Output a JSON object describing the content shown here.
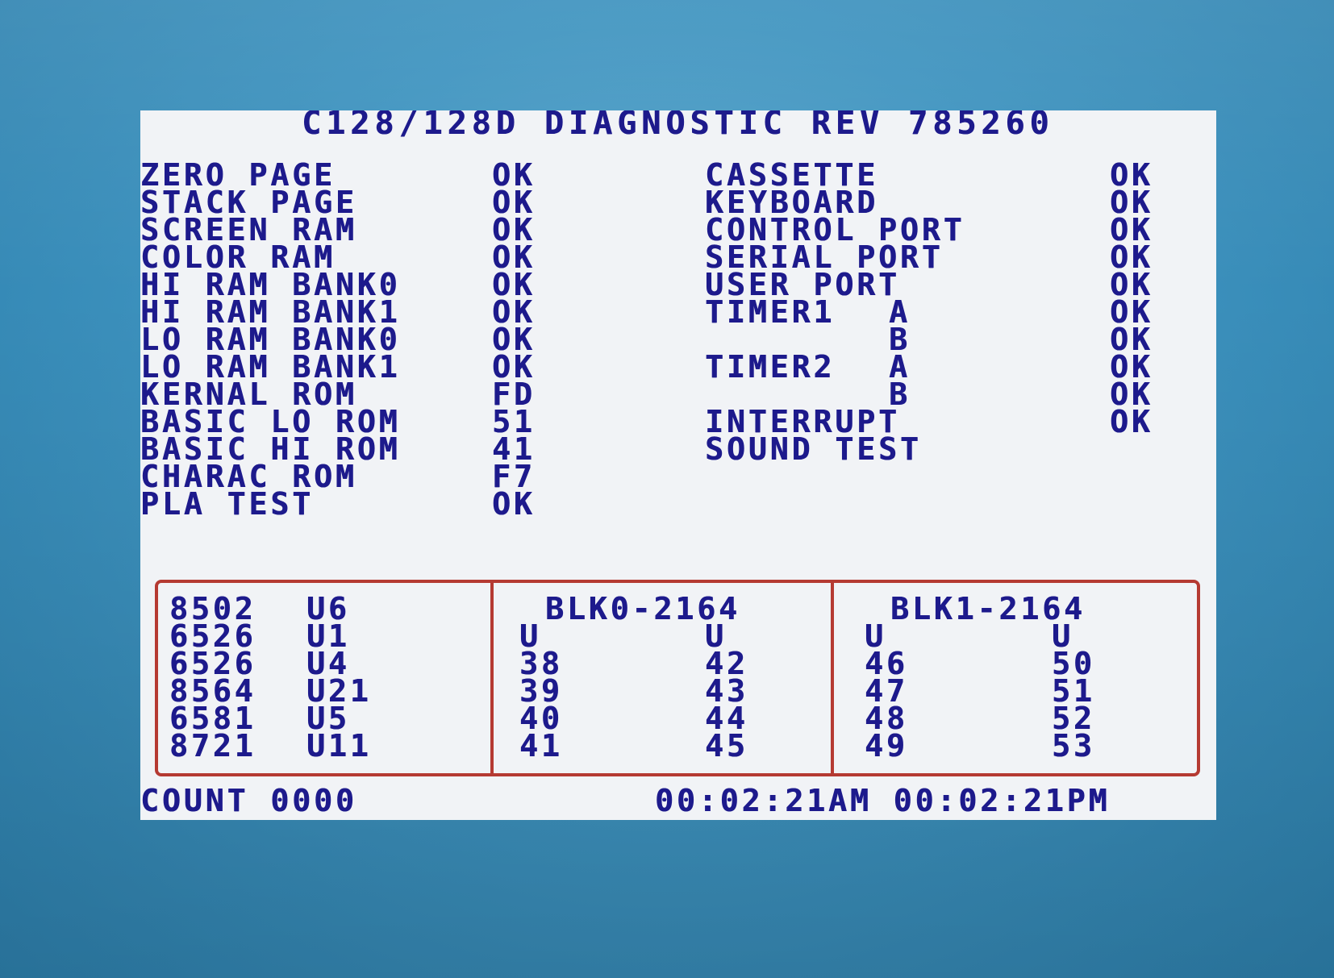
{
  "header": {
    "title": "C128/128D DIAGNOSTIC REV 785260"
  },
  "left_tests": [
    {
      "name": "ZERO PAGE",
      "result": "OK"
    },
    {
      "name": "STACK PAGE",
      "result": "OK"
    },
    {
      "name": "SCREEN RAM",
      "result": "OK"
    },
    {
      "name": "COLOR RAM",
      "result": "OK"
    },
    {
      "name": "HI RAM BANK0",
      "result": "OK"
    },
    {
      "name": "HI RAM BANK1",
      "result": "OK"
    },
    {
      "name": "LO RAM BANK0",
      "result": "OK"
    },
    {
      "name": "LO RAM BANK1",
      "result": "OK"
    },
    {
      "name": "KERNAL ROM",
      "result": "FD"
    },
    {
      "name": "BASIC LO ROM",
      "result": "51"
    },
    {
      "name": "BASIC HI ROM",
      "result": "41"
    },
    {
      "name": "CHARAC ROM",
      "result": "F7"
    },
    {
      "name": "PLA TEST",
      "result": "OK"
    }
  ],
  "right_tests": [
    {
      "name": "CASSETTE",
      "sub": "",
      "result": "OK"
    },
    {
      "name": "KEYBOARD",
      "sub": "",
      "result": "OK"
    },
    {
      "name": "CONTROL PORT",
      "sub": "",
      "result": "OK"
    },
    {
      "name": "SERIAL PORT",
      "sub": "",
      "result": "OK"
    },
    {
      "name": "USER PORT",
      "sub": "",
      "result": "OK"
    },
    {
      "name": "TIMER1",
      "sub": "A",
      "result": "OK"
    },
    {
      "name": "",
      "sub": "B",
      "result": "OK"
    },
    {
      "name": "TIMER2",
      "sub": "A",
      "result": "OK"
    },
    {
      "name": "",
      "sub": "B",
      "result": "OK"
    },
    {
      "name": "INTERRUPT",
      "sub": "",
      "result": "OK"
    },
    {
      "name": "SOUND TEST",
      "sub": "",
      "result": ""
    }
  ],
  "chips_panel": {
    "chips": [
      {
        "part": "8502",
        "loc": "U6"
      },
      {
        "part": "6526",
        "loc": "U1"
      },
      {
        "part": "6526",
        "loc": "U4"
      },
      {
        "part": "8564",
        "loc": "U21"
      },
      {
        "part": "6581",
        "loc": "U5"
      },
      {
        "part": "8721",
        "loc": "U11"
      }
    ],
    "blk0": {
      "header": "BLK0-2164",
      "col_header_a": "U",
      "col_header_b": "U",
      "col_a": [
        "38",
        "39",
        "40",
        "41"
      ],
      "col_b": [
        "42",
        "43",
        "44",
        "45"
      ]
    },
    "blk1": {
      "header": "BLK1-2164",
      "col_header_a": "U",
      "col_header_b": "U",
      "col_a": [
        "46",
        "47",
        "48",
        "49"
      ],
      "col_b": [
        "50",
        "51",
        "52",
        "53"
      ]
    }
  },
  "footer": {
    "count": "COUNT 0000",
    "time": "00:02:21AM 00:02:21PM"
  },
  "colors": {
    "text": "#1d1a8c",
    "screen": "#f1f3f6",
    "panel_border": "#b53a32",
    "bezel": "#3f94c0"
  }
}
